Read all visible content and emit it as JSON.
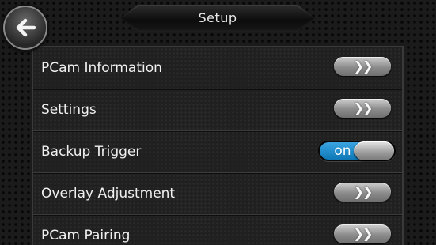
{
  "header": {
    "title": "Setup",
    "back_icon": "back-arrow-icon"
  },
  "rows": [
    {
      "label": "PCam Information",
      "control": "chevron-button",
      "icon": "double-chevron-right-icon"
    },
    {
      "label": "Settings",
      "control": "chevron-button",
      "icon": "double-chevron-right-icon"
    },
    {
      "label": "Backup Trigger",
      "control": "toggle",
      "toggle_label": "on",
      "toggle_state": "on"
    },
    {
      "label": "Overlay Adjustment",
      "control": "chevron-button",
      "icon": "double-chevron-right-icon"
    },
    {
      "label": "PCam Pairing",
      "control": "chevron-button",
      "icon": "double-chevron-right-icon"
    }
  ],
  "colors": {
    "toggle_accent": "#1a8fd4",
    "background": "#1b1b1b",
    "text": "#f0f0f0"
  }
}
